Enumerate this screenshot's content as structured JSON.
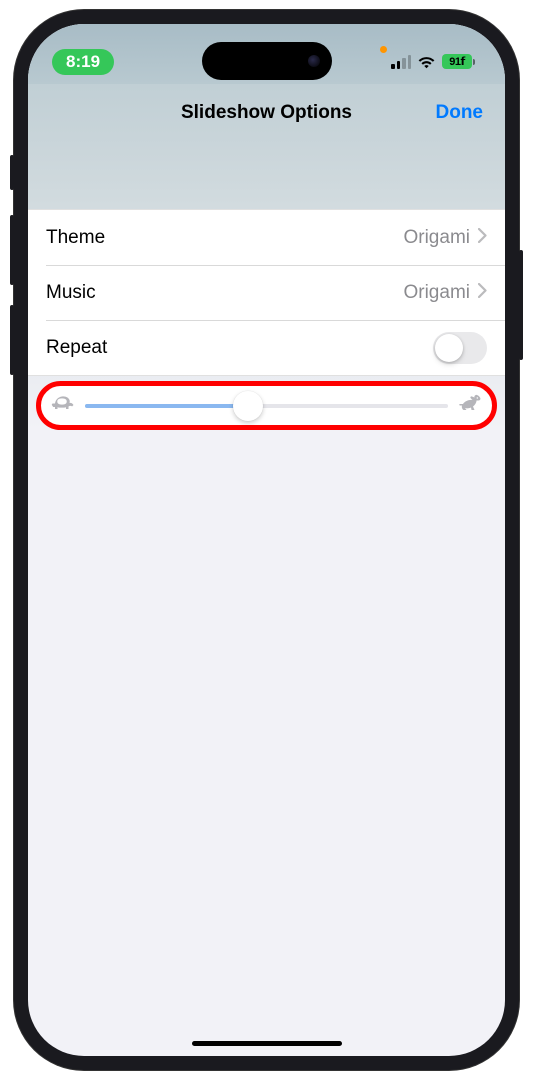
{
  "status": {
    "time": "8:19",
    "battery_text": "91",
    "battery_charging_glyph": "𐐩"
  },
  "header": {
    "title": "Slideshow Options",
    "done_label": "Done"
  },
  "options": {
    "theme": {
      "label": "Theme",
      "value": "Origami"
    },
    "music": {
      "label": "Music",
      "value": "Origami"
    },
    "repeat": {
      "label": "Repeat",
      "enabled": false
    }
  },
  "speed_slider": {
    "value_percent": 45,
    "slow_icon": "turtle",
    "fast_icon": "rabbit"
  },
  "colors": {
    "accent": "#007aff",
    "highlight_border": "#ff0000",
    "status_green": "#35c759"
  }
}
